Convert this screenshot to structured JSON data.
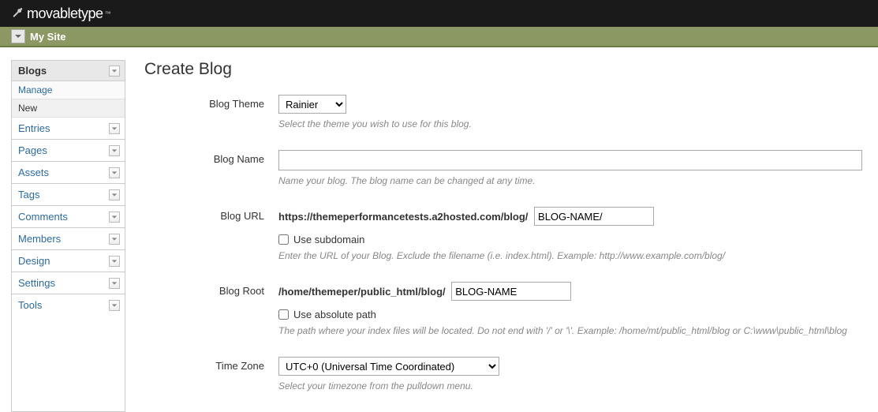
{
  "brand": "movabletype",
  "brand_tm": "™",
  "site_name": "My Site",
  "sidebar": {
    "head": "Blogs",
    "sub": [
      "Manage",
      "New"
    ],
    "items": [
      "Entries",
      "Pages",
      "Assets",
      "Tags",
      "Comments",
      "Members",
      "Design",
      "Settings",
      "Tools"
    ]
  },
  "page_title": "Create Blog",
  "form": {
    "theme": {
      "label": "Blog Theme",
      "value": "Rainier",
      "hint": "Select the theme you wish to use for this blog."
    },
    "name": {
      "label": "Blog Name",
      "value": "",
      "hint": "Name your blog. The blog name can be changed at any time."
    },
    "url": {
      "label": "Blog URL",
      "prefix": "https://themeperformancetests.a2hosted.com/blog/",
      "value": "BLOG-NAME/",
      "subdomain_label": "Use subdomain",
      "hint": "Enter the URL of your Blog. Exclude the filename (i.e. index.html). Example: http://www.example.com/blog/"
    },
    "root": {
      "label": "Blog Root",
      "prefix": "/home/themeper/public_html/blog/",
      "value": "BLOG-NAME",
      "absolute_label": "Use absolute path",
      "hint": "The path where your index files will be located. Do not end with '/' or '\\'. Example: /home/mt/public_html/blog or C:\\www\\public_html\\blog"
    },
    "timezone": {
      "label": "Time Zone",
      "value": "UTC+0 (Universal Time Coordinated)",
      "hint": "Select your timezone from the pulldown menu."
    }
  }
}
